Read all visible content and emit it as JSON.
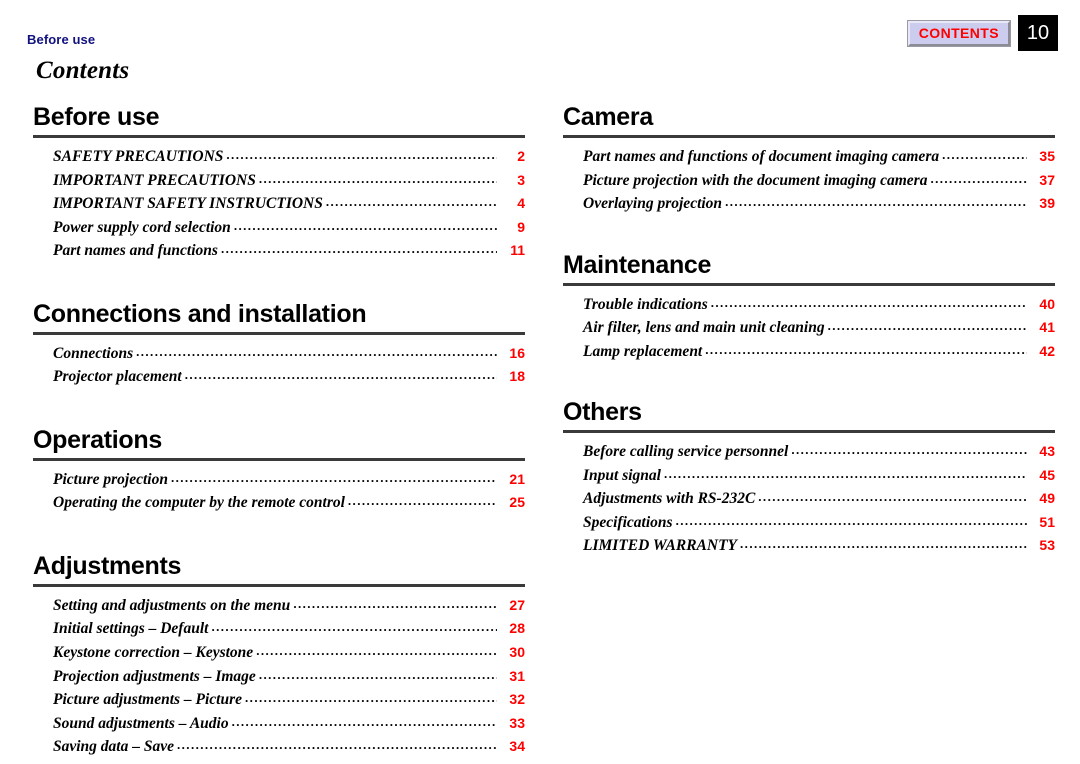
{
  "header": {
    "running_head": "Before use",
    "contents_badge_label": "CONTENTS",
    "page_number": "10",
    "badge_bg_color": "#ccccee",
    "badge_text_color": "#ff0000",
    "running_head_color": "#11117f",
    "page_box_bg_color": "#000000"
  },
  "title": "Contents",
  "accent_color": "#ff0000",
  "rule_color": "#3a3a3a",
  "left_column": [
    {
      "heading": "Before use",
      "entries": [
        {
          "title": "SAFETY PRECAUTIONS",
          "page": "2"
        },
        {
          "title": "IMPORTANT PRECAUTIONS",
          "page": "3"
        },
        {
          "title": "IMPORTANT SAFETY INSTRUCTIONS",
          "page": "4"
        },
        {
          "title": "Power supply cord selection",
          "page": "9"
        },
        {
          "title": "Part names and functions",
          "page": "11"
        }
      ]
    },
    {
      "heading": "Connections and installation",
      "entries": [
        {
          "title": "Connections",
          "page": "16"
        },
        {
          "title": "Projector placement",
          "page": "18"
        }
      ]
    },
    {
      "heading": "Operations",
      "entries": [
        {
          "title": "Picture projection",
          "page": "21"
        },
        {
          "title": "Operating the computer by the remote control",
          "page": "25"
        }
      ]
    },
    {
      "heading": "Adjustments",
      "entries": [
        {
          "title": "Setting and adjustments on the menu",
          "page": "27"
        },
        {
          "title": "Initial settings – Default",
          "page": "28"
        },
        {
          "title": "Keystone correction – Keystone",
          "page": "30"
        },
        {
          "title": "Projection adjustments – Image",
          "page": "31"
        },
        {
          "title": "Picture adjustments – Picture",
          "page": "32"
        },
        {
          "title": "Sound adjustments – Audio",
          "page": "33"
        },
        {
          "title": "Saving data – Save",
          "page": "34"
        }
      ]
    }
  ],
  "right_column": [
    {
      "heading": "Camera",
      "entries": [
        {
          "title": "Part names and functions of document imaging camera",
          "page": "35"
        },
        {
          "title": "Picture projection with the document imaging camera",
          "page": "37"
        },
        {
          "title": "Overlaying projection",
          "page": "39"
        }
      ]
    },
    {
      "heading": "Maintenance",
      "entries": [
        {
          "title": "Trouble indications",
          "page": "40"
        },
        {
          "title": "Air filter, lens and main unit cleaning",
          "page": "41"
        },
        {
          "title": "Lamp replacement",
          "page": "42"
        }
      ]
    },
    {
      "heading": "Others",
      "entries": [
        {
          "title": "Before calling service personnel",
          "page": "43"
        },
        {
          "title": "Input signal",
          "page": "45"
        },
        {
          "title": "Adjustments with RS-232C",
          "page": "49"
        },
        {
          "title": "Specifications",
          "page": "51"
        },
        {
          "title": "LIMITED WARRANTY",
          "page": "53"
        }
      ]
    }
  ]
}
